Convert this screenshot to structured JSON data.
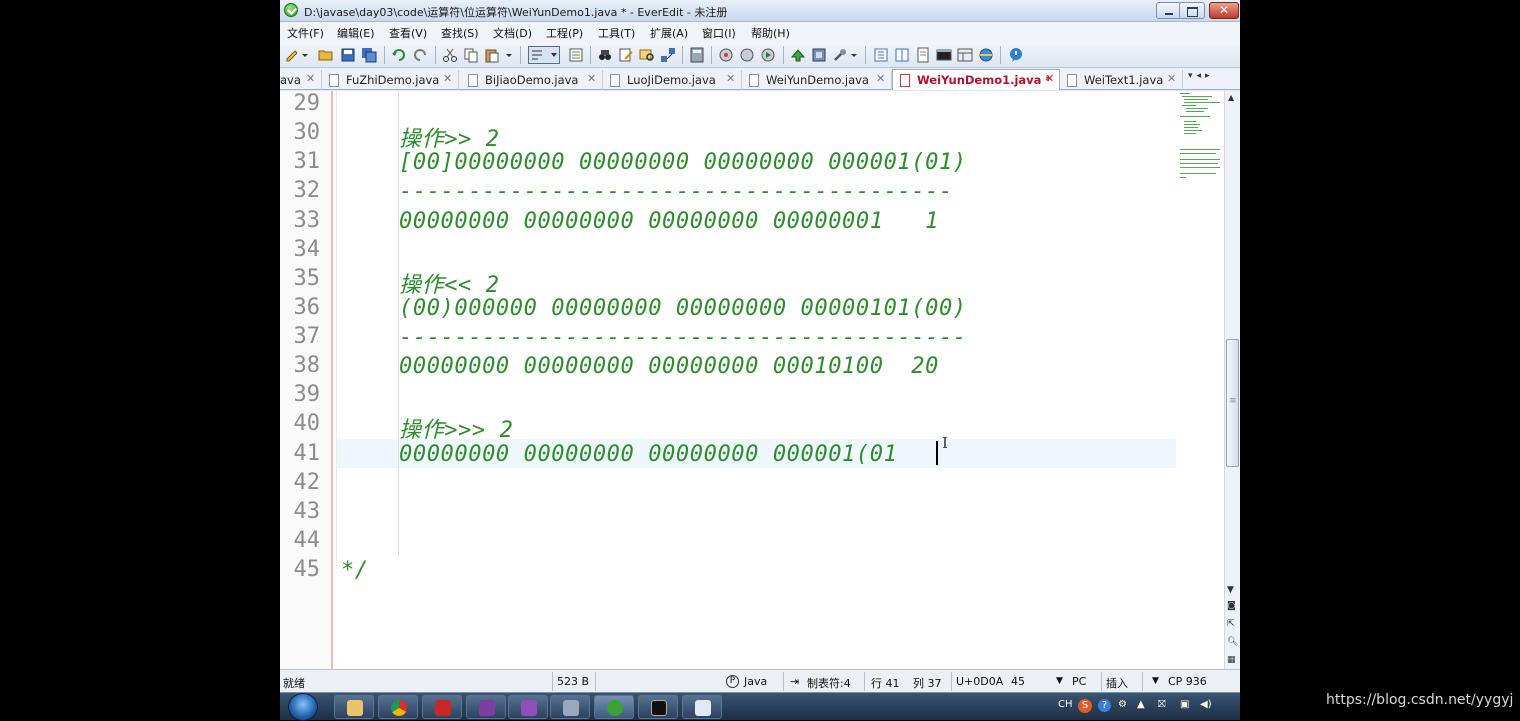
{
  "window": {
    "title": "D:\\javase\\day03\\code\\运算符\\位运算符\\WeiYunDemo1.java * - EverEdit - 未注册"
  },
  "menu": [
    "文件(F)",
    "编辑(E)",
    "查看(V)",
    "查找(S)",
    "文档(D)",
    "工程(P)",
    "工具(T)",
    "扩展(A)",
    "窗口(I)",
    "帮助(H)"
  ],
  "tabs": [
    {
      "label": "ava",
      "active": false
    },
    {
      "label": "FuZhiDemo.java",
      "active": false
    },
    {
      "label": "BiJiaoDemo.java",
      "active": false
    },
    {
      "label": "LuoJiDemo.java",
      "active": false
    },
    {
      "label": "WeiYunDemo.java",
      "active": false
    },
    {
      "label": "WeiYunDemo1.java *",
      "active": true
    },
    {
      "label": "WeiText1.java",
      "active": false
    }
  ],
  "editor": {
    "lines": [
      {
        "n": "29",
        "text": ""
      },
      {
        "n": "30",
        "text": "操作>> 2"
      },
      {
        "n": "31",
        "text": "[00]00000000 00000000 00000000 000001(01)"
      },
      {
        "n": "32",
        "text": "----------------------------------------"
      },
      {
        "n": "33",
        "text": "00000000 00000000 00000000 00000001   1"
      },
      {
        "n": "34",
        "text": ""
      },
      {
        "n": "35",
        "text": "操作<< 2"
      },
      {
        "n": "36",
        "text": "(00)000000 00000000 00000000 00000101(00)"
      },
      {
        "n": "37",
        "text": "-----------------------------------------"
      },
      {
        "n": "38",
        "text": "00000000 00000000 00000000 00010100  20"
      },
      {
        "n": "39",
        "text": ""
      },
      {
        "n": "40",
        "text": "操作>>> 2"
      },
      {
        "n": "41",
        "text": "00000000 00000000 00000000 000001(01"
      },
      {
        "n": "42",
        "text": ""
      },
      {
        "n": "43",
        "text": ""
      },
      {
        "n": "44",
        "text": ""
      },
      {
        "n": "45",
        "text": "*/"
      }
    ]
  },
  "status": {
    "ready": "就绪",
    "size": "523 B",
    "syntax": "Java",
    "tab_setting": "制表符:4",
    "line": "行 41",
    "col": "列 37",
    "char_code": "U+0D0A",
    "char_num": "45",
    "line_ending": "PC",
    "insert_mode": "插入",
    "codepage": "CP 936"
  },
  "taskbar": {
    "lang": "CH"
  },
  "watermark": "https://blog.csdn.net/yygyj",
  "colors": {
    "code_text": "#2e8b2e",
    "line_number": "#8c8c8c",
    "active_tab_text": "#b3122a",
    "current_line": "#eef8fc"
  }
}
